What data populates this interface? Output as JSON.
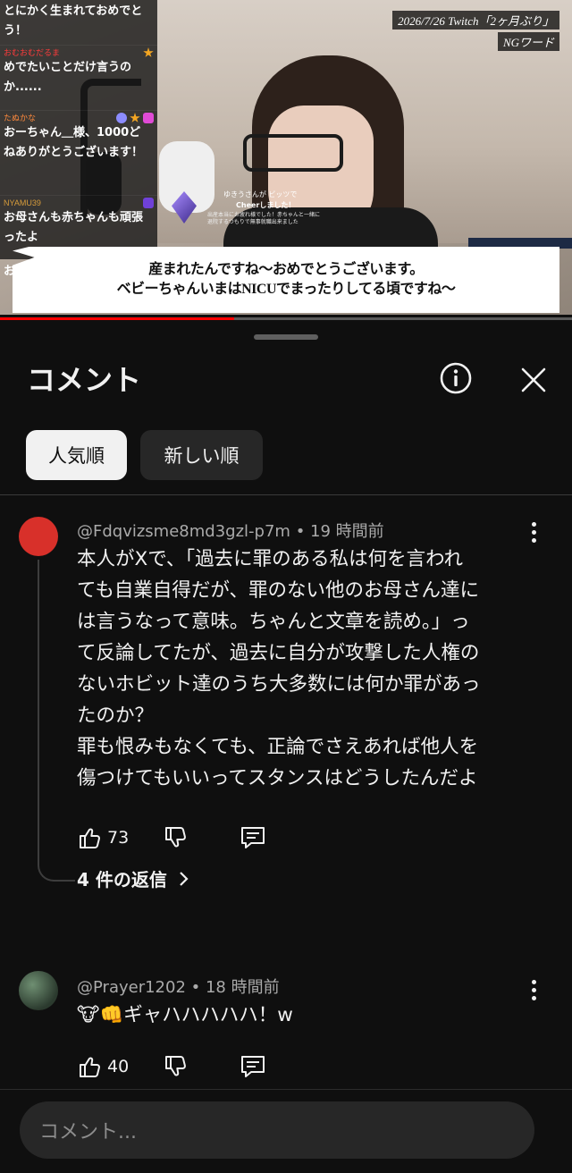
{
  "video": {
    "stream_title": "2026/7/26 Twitch「2ヶ月ぶり」",
    "ng_label": "NGワード",
    "subtitle_lines": [
      "産まれたんですね～おめでとうございます。",
      "ベビーちゃんいまはNICUでまったりしてる頃ですね～"
    ],
    "cheer": {
      "line1": "ゆきうさんが  ビッツで",
      "line2": "Cheerしました！",
      "line3": "出産本当にお疲れ様でした！赤ちゃんと一緒に退院するつもりで無事就職出来ました"
    },
    "chat": [
      {
        "user": "",
        "text": "とにかく生まれておめでとう！",
        "user_color": "#ff5b5b"
      },
      {
        "user": "おむおむだるま",
        "text": "めでたいことだけ言うのか......",
        "user_color": "#ff3b3b"
      },
      {
        "user": "たぬかな",
        "text": "おーちゃん＿様、1000どねありがとうございます！",
        "user_color": "#ff8a3d"
      },
      {
        "user": "NYAMU39",
        "text": "お母さんも赤ちゃんも頑張ったよ",
        "user_color": "#d79c3b"
      }
    ],
    "chat_partial": "お",
    "progress_percent": 41
  },
  "panel": {
    "title": "コメント",
    "sort_chips": [
      "人気順",
      "新しい順"
    ],
    "active_chip": 0,
    "input_placeholder": "コメント..."
  },
  "comments": [
    {
      "author": "@Fdqvizsme8md3gzl-p7m",
      "time": "19 時間前",
      "avatar_color": "#d8302a",
      "lines": [
        "本人がXで、「過去に罪のある私は何を言われ",
        "ても自業自得だが、罪のない他のお母さん達に",
        "は言うなって意味。ちゃんと文章を読め。」っ",
        "て反論してたが、過去に自分が攻撃した人権の",
        "ないホビット達のうち大多数には何か罪があっ",
        "たのか？",
        "罪も恨みもなくても、正論でさえあれば他人を",
        "傷つけてもいいってスタンスはどうしたんだよ"
      ],
      "likes": "73",
      "replies_label": "4 件の返信"
    },
    {
      "author": "@Prayer1202",
      "time": "18 時間前",
      "avatar_color": "#3a4a3c",
      "lines": [
        "🐮👊ギャハハハハハ！w"
      ],
      "likes": "40"
    }
  ]
}
